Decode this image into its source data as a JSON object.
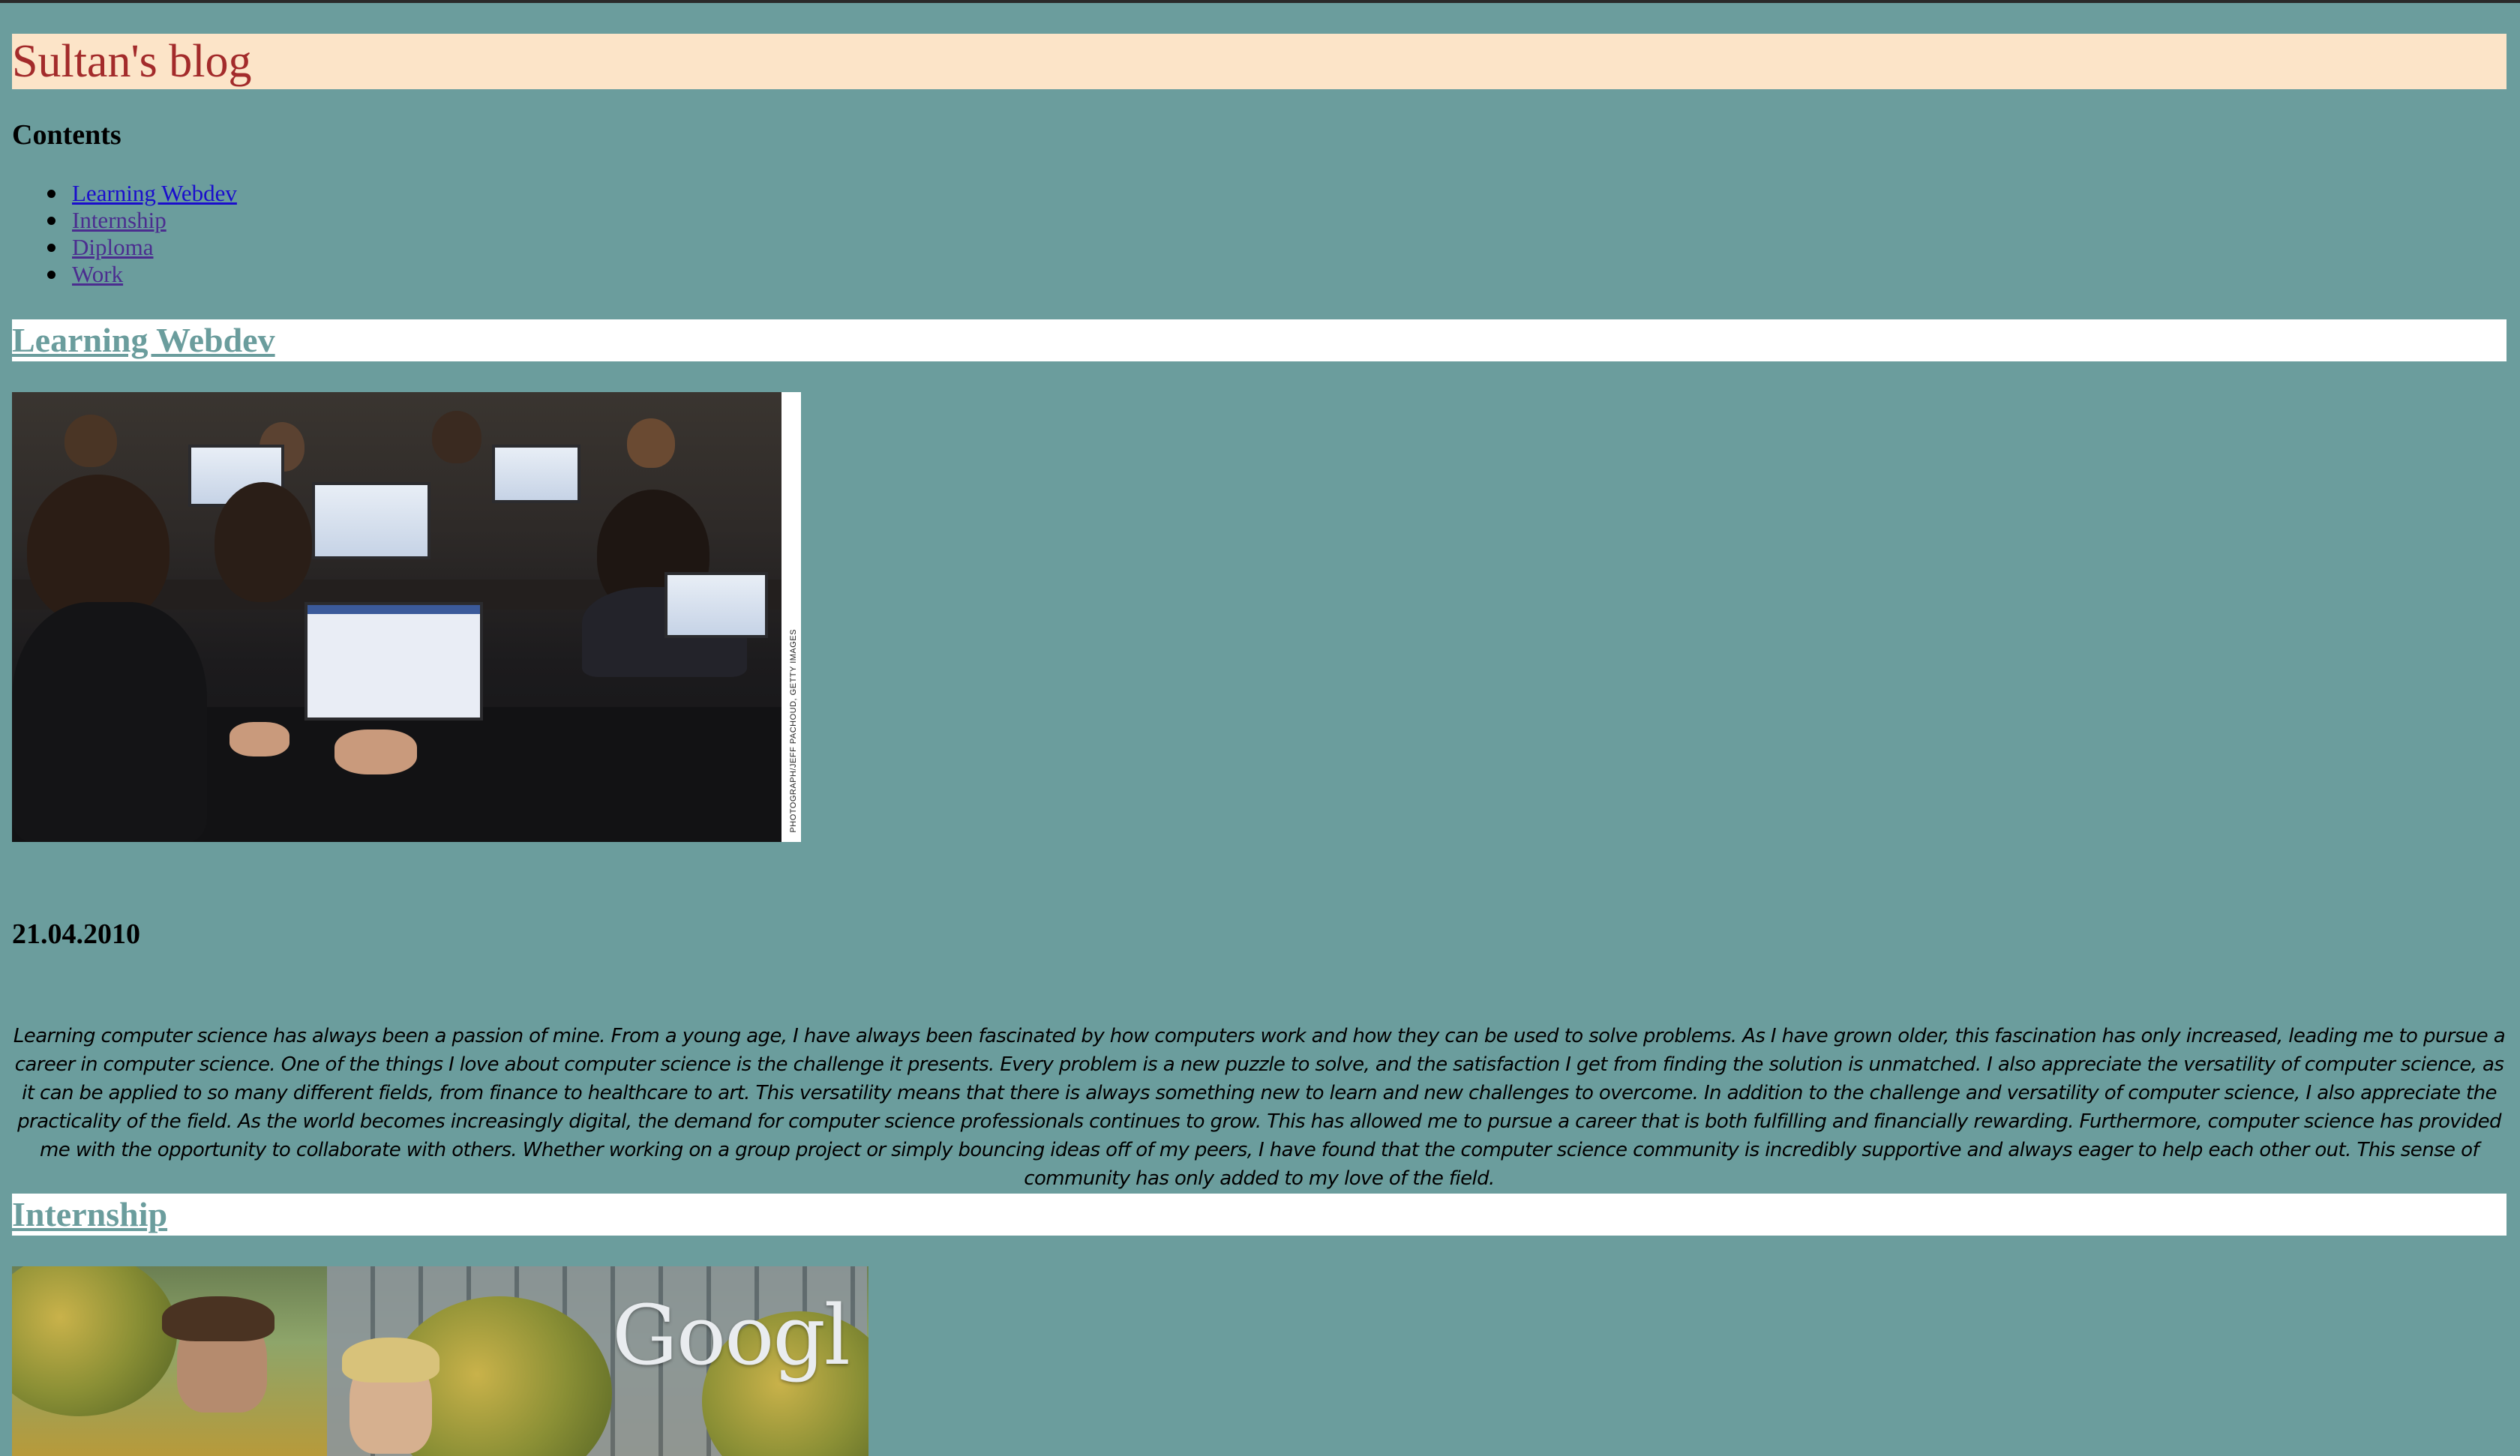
{
  "blog": {
    "title": "Sultan's blog"
  },
  "contents": {
    "heading": "Contents",
    "items": [
      {
        "label": "Learning Webdev"
      },
      {
        "label": "Internship"
      },
      {
        "label": "Diploma"
      },
      {
        "label": "Work"
      }
    ]
  },
  "sections": [
    {
      "heading": "Learning Webdev",
      "image_credit": "PHOTOGRAPH/JEFF PACHOUD, GETTY IMAGES",
      "date": "21.04.2010",
      "body": "Learning computer science has always been a passion of mine. From a young age, I have always been fascinated by how computers work and how they can be used to solve problems. As I have grown older, this fascination has only increased, leading me to pursue a career in computer science. One of the things I love about computer science is the challenge it presents. Every problem is a new puzzle to solve, and the satisfaction I get from finding the solution is unmatched. I also appreciate the versatility of computer science, as it can be applied to so many different fields, from finance to healthcare to art. This versatility means that there is always something new to learn and new challenges to overcome. In addition to the challenge and versatility of computer science, I also appreciate the practicality of the field. As the world becomes increasingly digital, the demand for computer science professionals continues to grow. This has allowed me to pursue a career that is both fulfilling and financially rewarding. Furthermore, computer science has provided me with the opportunity to collaborate with others. Whether working on a group project or simply bouncing ideas off of my peers, I have found that the computer science community is incredibly supportive and always eager to help each other out. This sense of community has only added to my love of the field."
    },
    {
      "heading": "Internship",
      "image_sign": "Googl"
    }
  ],
  "colors": {
    "page_background": "#6b9d9d",
    "header_background": "#fce4c8",
    "title_color": "#a32b2b",
    "section_bar_background": "#ffffff",
    "section_heading_color": "#6b9d9d",
    "link_color": "#1a0dcc",
    "visited_link_color": "#4b2d8f"
  }
}
